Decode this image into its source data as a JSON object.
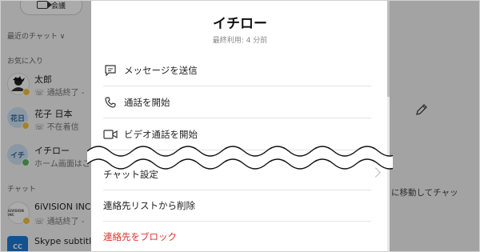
{
  "sidebar": {
    "meet_label": "会議",
    "recent_label": "最近のチャット ∨",
    "favorites_label": "お気に入り",
    "chats_label": "チャット",
    "favorites": [
      {
        "name": "太郎",
        "sub": "通話終了 -",
        "avatar_text": "",
        "status": "away"
      },
      {
        "name": "花子 日本",
        "sub": "不在着信",
        "avatar_text": "花日",
        "status": "away"
      },
      {
        "name": "イチロー",
        "sub": "ホーム画面はこ",
        "avatar_text": "イチ",
        "status": "online"
      }
    ],
    "chats": [
      {
        "name": "6iVISION INC",
        "sub": "通話終了 -",
        "avatar_text": "6iVISION INC",
        "status": "away"
      },
      {
        "name": "Skype subtitle",
        "sub": "",
        "avatar_text": "CC",
        "status": "none"
      }
    ]
  },
  "panel": {
    "title": "イチロー",
    "last_used": "最終利用: 4 分前",
    "items": [
      {
        "label": "メッセージを送信",
        "icon": "message-icon"
      },
      {
        "label": "通話を開始",
        "icon": "phone-icon"
      },
      {
        "label": "ビデオ通話を開始",
        "icon": "video-icon"
      },
      {
        "label": "チャット設定",
        "icon": ""
      },
      {
        "label": "連絡先リストから削除",
        "icon": ""
      },
      {
        "label": "連絡先をブロック",
        "icon": ""
      }
    ]
  },
  "right": {
    "hint": "に移動してチャッ"
  },
  "colors": {
    "danger": "#e0342b",
    "online": "#5cb85c",
    "away": "#f5c242"
  }
}
